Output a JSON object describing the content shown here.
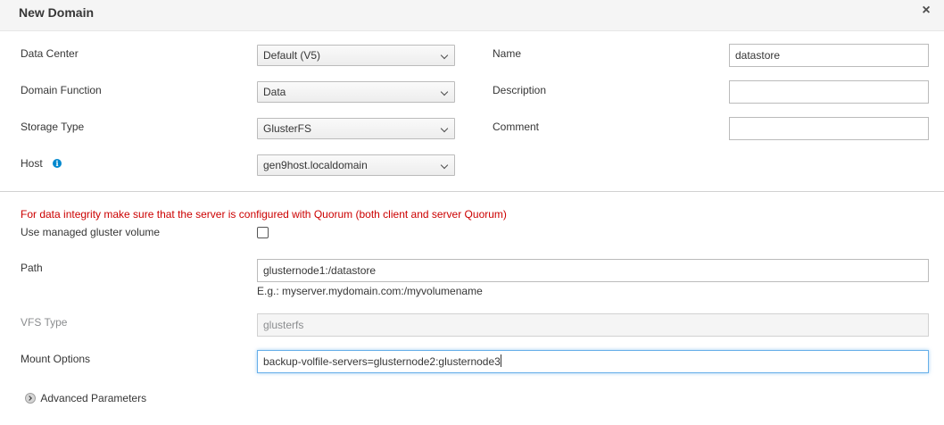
{
  "dialog": {
    "title": "New Domain",
    "close_glyph": "×"
  },
  "fields": {
    "data_center": {
      "label": "Data Center",
      "value": "Default (V5)"
    },
    "domain_function": {
      "label": "Domain Function",
      "value": "Data"
    },
    "storage_type": {
      "label": "Storage Type",
      "value": "GlusterFS"
    },
    "host": {
      "label": "Host",
      "value": "gen9host.localdomain",
      "info_icon": "info-icon"
    },
    "name": {
      "label": "Name",
      "value": "datastore"
    },
    "description": {
      "label": "Description",
      "value": ""
    },
    "comment": {
      "label": "Comment",
      "value": ""
    }
  },
  "gluster": {
    "warning": "For data integrity make sure that the server is configured with Quorum (both client and server Quorum)",
    "managed_volume_label": "Use managed gluster volume",
    "managed_volume_checked": false,
    "path_label": "Path",
    "path_value": "glusternode1:/datastore",
    "path_hint": "E.g.: myserver.mydomain.com:/myvolumename",
    "vfs_label": "VFS Type",
    "vfs_value": "glusterfs",
    "mount_label": "Mount Options",
    "mount_value": "backup-volfile-servers=glusternode2:glusternode3"
  },
  "advanced": {
    "label": "Advanced Parameters",
    "icon": "chevron-right-icon"
  },
  "colors": {
    "warning": "#cc0000",
    "info_icon": "#0088ce",
    "focus_border": "#66afe9"
  }
}
